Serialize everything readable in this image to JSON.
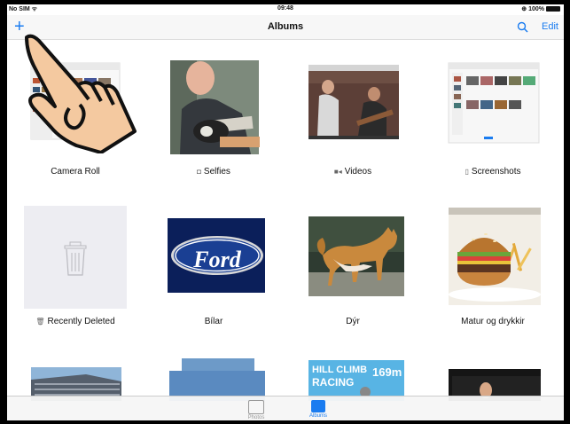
{
  "status": {
    "carrier": "No SIM ᯤ",
    "time": "09:48",
    "battery": "⊕ 100%"
  },
  "nav": {
    "add_symbol": "+",
    "title": "Albums",
    "edit_label": "Edit"
  },
  "albums": [
    {
      "name": "Camera Roll",
      "icon": ""
    },
    {
      "name": "Selfies",
      "icon": "camera-icon"
    },
    {
      "name": "Videos",
      "icon": "video-icon"
    },
    {
      "name": "Screenshots",
      "icon": "phone-icon"
    },
    {
      "name": "Recently Deleted",
      "icon": "trash-icon"
    },
    {
      "name": "Bílar",
      "icon": ""
    },
    {
      "name": "Dýr",
      "icon": ""
    },
    {
      "name": "Matur og drykkir",
      "icon": ""
    }
  ],
  "thumb_text": {
    "ford_logo": "Ford",
    "game_title_1": "HILL CLIMB",
    "game_title_2": "RACING",
    "game_score": "169m"
  },
  "tabs": [
    {
      "label": "Photos"
    },
    {
      "label": "Albums"
    }
  ],
  "colors": {
    "accent": "#1a7cf0",
    "tab_inactive": "#999999"
  }
}
